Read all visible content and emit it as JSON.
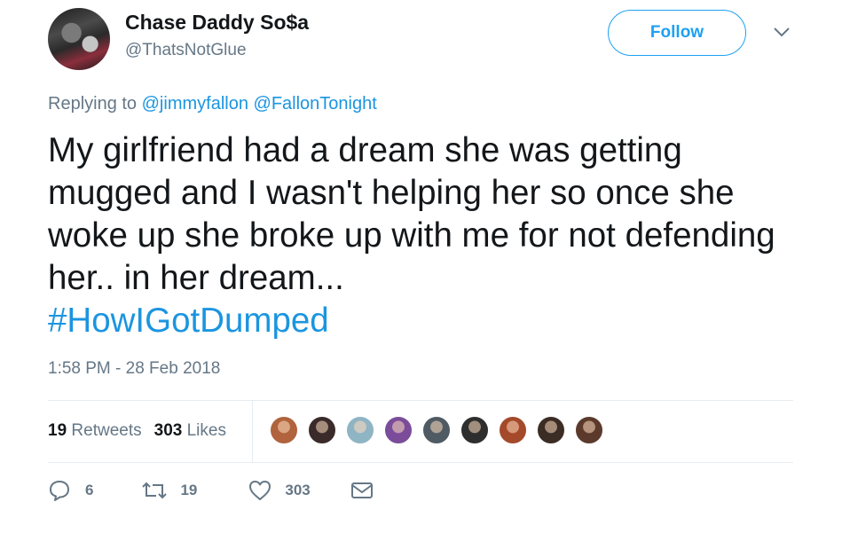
{
  "user": {
    "name": "Chase Daddy So$a",
    "handle": "@ThatsNotGlue"
  },
  "follow_label": "Follow",
  "reply_context": {
    "prefix": "Replying to",
    "mentions": [
      "@jimmyfallon",
      "@FallonTonight"
    ]
  },
  "tweet": {
    "text": "My girlfriend had a dream she was getting mugged and I wasn't helping her so once she woke up she broke up with me for not defending her.. in her dream...",
    "hashtag": "#HowIGotDumped",
    "timestamp": "1:58 PM - 28 Feb 2018"
  },
  "stats": {
    "retweets_count": "19",
    "retweets_label": "Retweets",
    "likes_count": "303",
    "likes_label": "Likes"
  },
  "likers": [
    {
      "name": "liker-1",
      "color": "#b0633c"
    },
    {
      "name": "liker-2",
      "color": "#3a2a2a"
    },
    {
      "name": "liker-3",
      "color": "#8fb4c4"
    },
    {
      "name": "liker-4",
      "color": "#7a4c9a"
    },
    {
      "name": "liker-5",
      "color": "#4f5a63"
    },
    {
      "name": "liker-6",
      "color": "#2e2e2e"
    },
    {
      "name": "liker-7",
      "color": "#a44a2a"
    },
    {
      "name": "liker-8",
      "color": "#3b2c24"
    },
    {
      "name": "liker-9",
      "color": "#5b3a2c"
    }
  ],
  "actions": {
    "reply_count": "6",
    "retweet_count": "19",
    "like_count": "303",
    "icons": [
      "reply-icon",
      "retweet-icon",
      "like-icon",
      "direct-message-icon"
    ]
  },
  "colors": {
    "accent": "#1da1f2",
    "link": "#1b95e0",
    "secondary_text": "#657786",
    "primary_text": "#14171a",
    "divider": "#e6ecf0"
  }
}
